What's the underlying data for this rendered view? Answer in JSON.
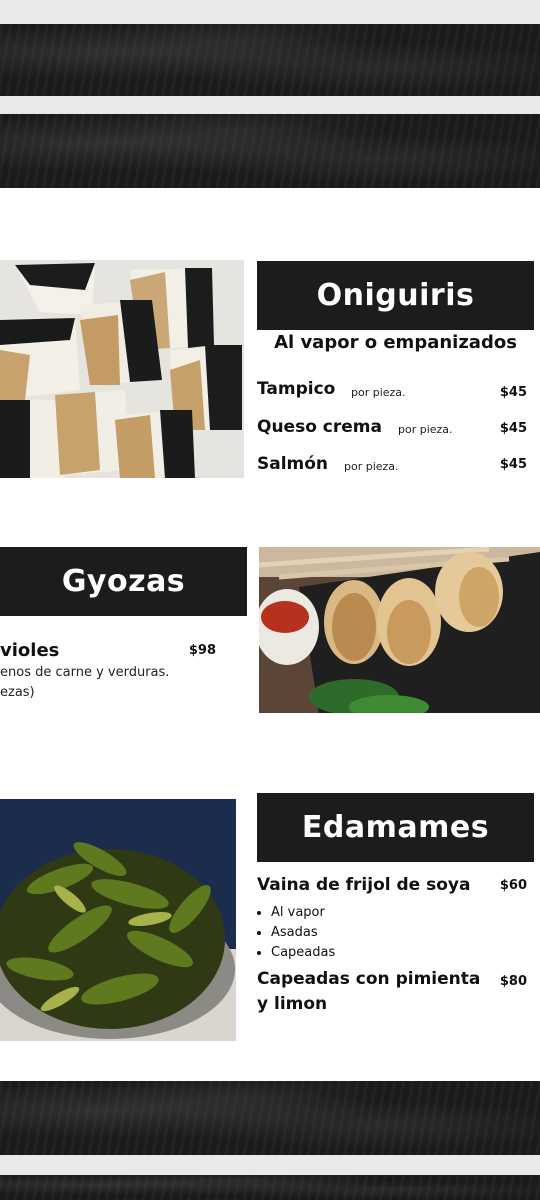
{
  "oniguiris": {
    "title": "Oniguiris",
    "subtitle": "Al vapor o empanizados",
    "items": [
      {
        "name": "Tampico",
        "note": "por pieza.",
        "price": "$45"
      },
      {
        "name": "Queso crema",
        "note": "por pieza.",
        "price": "$45"
      },
      {
        "name": "Salmón",
        "note": "por pieza.",
        "price": "$45"
      }
    ]
  },
  "gyozas": {
    "title": "Gyozas",
    "item_name": "violes",
    "price": "$98",
    "desc_line1": "enos de carne y verduras.",
    "desc_line2": "ezas)"
  },
  "edamames": {
    "title": "Edamames",
    "item1_name": "Vaina de frijol de soya",
    "item1_price": "$60",
    "options": [
      "Al vapor",
      "Asadas",
      "Capeadas"
    ],
    "item2_name_line1": "Capeadas con pimienta",
    "item2_name_line2": "y limon",
    "item2_price": "$80"
  },
  "colors": {
    "title_bg": "#1c1c1c",
    "banner_bg": "#1b1b1b",
    "page_bg": "#ffffff"
  }
}
